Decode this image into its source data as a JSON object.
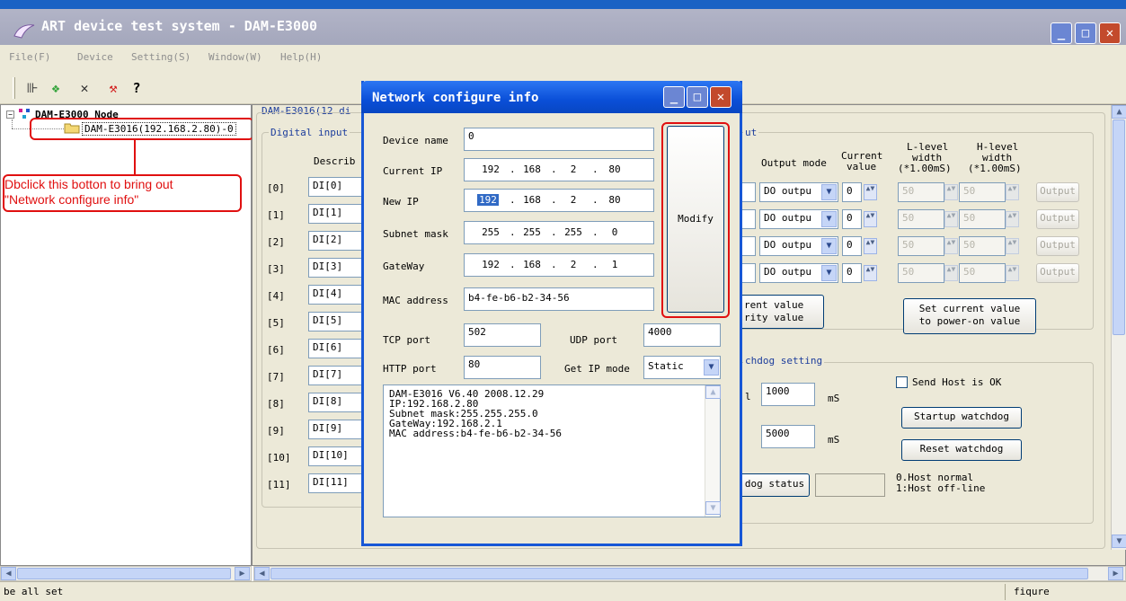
{
  "window": {
    "title": "ART device test system - DAM-E3000"
  },
  "menu": [
    "File(F)",
    "Device",
    "Setting(S)",
    "Window(W)",
    "Help(H)"
  ],
  "tree": {
    "root": "DAM-E3000 Node",
    "child": "DAM-E3016(192.168.2.80)-0"
  },
  "annotation": {
    "line1": "Dbclick this botton to bring out",
    "line2": "\"Network configure info\""
  },
  "right": {
    "header": "DAM-E3016(12 di",
    "digital_input_title": "Digital input",
    "describ_header": "Describ",
    "di_rows": [
      {
        "idx": "[0]",
        "name": "DI[0]"
      },
      {
        "idx": "[1]",
        "name": "DI[1]"
      },
      {
        "idx": "[2]",
        "name": "DI[2]"
      },
      {
        "idx": "[3]",
        "name": "DI[3]"
      },
      {
        "idx": "[4]",
        "name": "DI[4]"
      },
      {
        "idx": "[5]",
        "name": "DI[5]"
      },
      {
        "idx": "[6]",
        "name": "DI[6]"
      },
      {
        "idx": "[7]",
        "name": "DI[7]"
      },
      {
        "idx": "[8]",
        "name": "DI[8]"
      },
      {
        "idx": "[9]",
        "name": "DI[9]"
      },
      {
        "idx": "[10]",
        "name": "DI[10]"
      },
      {
        "idx": "[11]",
        "name": "DI[11]"
      }
    ],
    "output_title": "ut",
    "col_output_mode": "Output mode",
    "col_current_value_1": "Current",
    "col_current_value_2": "value",
    "col_l_level_1": "L-level",
    "col_l_level_2": "width",
    "col_l_level_3": "(*1.00mS)",
    "col_h_level_1": "H-level",
    "col_h_level_2": "width",
    "col_h_level_3": "(*1.00mS)",
    "do_rows": [
      {
        "mode": "DO outpu",
        "value": "0",
        "l": "50",
        "h": "50",
        "btn": "Output"
      },
      {
        "mode": "DO outpu",
        "value": "0",
        "l": "50",
        "h": "50",
        "btn": "Output"
      },
      {
        "mode": "DO outpu",
        "value": "0",
        "l": "50",
        "h": "50",
        "btn": "Output"
      },
      {
        "mode": "DO outpu",
        "value": "0",
        "l": "50",
        "h": "50",
        "btn": "Output"
      }
    ],
    "btn_current_1": "rent value",
    "btn_current_2": "rity value",
    "btn_set_1": "Set current value",
    "btn_set_2": "to power-on value",
    "watchdog_title": "chdog setting",
    "wd_label1": "l",
    "wd_value1": "1000",
    "wd_unit1": "mS",
    "wd_value2": "5000",
    "wd_unit2": "mS",
    "send_host": "Send Host is OK",
    "startup_watchdog": "Startup watchdog",
    "reset_watchdog": "Reset watchdog",
    "dog_status": "dog status",
    "host_normal": "0.Host normal",
    "host_offline": "1:Host off-line"
  },
  "dialog": {
    "title": "Network configure info",
    "device_name_label": "Device name",
    "device_name_value": "0",
    "current_ip_label": "Current IP",
    "current_ip": [
      "192",
      "168",
      "2",
      "80"
    ],
    "new_ip_label": "New IP",
    "new_ip": [
      "192",
      "168",
      "2",
      "80"
    ],
    "subnet_label": "Subnet mask",
    "subnet": [
      "255",
      "255",
      "255",
      "0"
    ],
    "gateway_label": "GateWay",
    "gateway": [
      "192",
      "168",
      "2",
      "1"
    ],
    "mac_label": "MAC address",
    "mac_value": "b4-fe-b6-b2-34-56",
    "modify_button": "Modify",
    "tcp_label": "TCP port",
    "tcp_value": "502",
    "udp_label": "UDP port",
    "udp_value": "4000",
    "http_label": "HTTP port",
    "http_value": "80",
    "getip_label": "Get IP mode",
    "getip_value": "Static",
    "info_lines": [
      "DAM-E3016 V6.40 2008.12.29",
      "IP:192.168.2.80",
      "Subnet mask:255.255.255.0",
      "GateWay:192.168.2.1",
      "MAC address:b4-fe-b6-b2-34-56"
    ]
  },
  "status": {
    "left": "be all set",
    "right": "fiqure"
  },
  "colors": {
    "titlebar": "#a4a7bc",
    "dialog_title": "#0a4fd8",
    "annotation": "#e01010",
    "window_bg": "#ece9d8"
  }
}
